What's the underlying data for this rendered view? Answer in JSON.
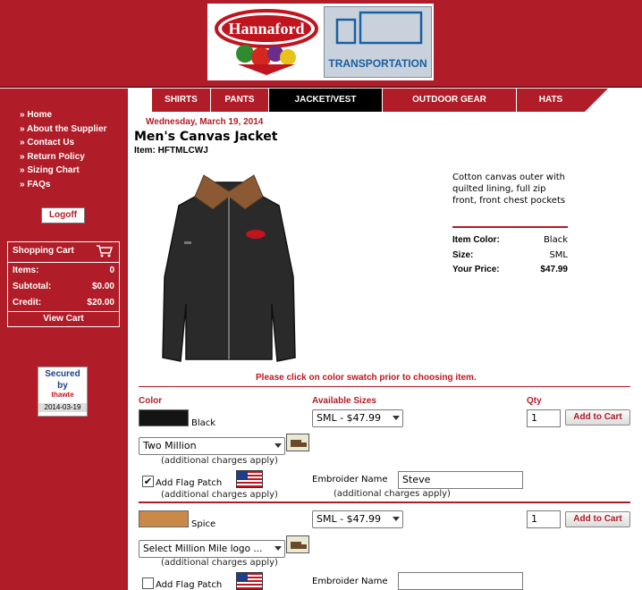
{
  "header": {
    "logo_text": "Hannaford",
    "logo_secondary_text": "TRANSPORTATION"
  },
  "nav": {
    "items": [
      {
        "label": "SHIRTS"
      },
      {
        "label": "PANTS"
      },
      {
        "label": "JACKET/VEST"
      },
      {
        "label": "OUTDOOR GEAR"
      },
      {
        "label": "HATS"
      }
    ]
  },
  "sidebar": {
    "links": [
      {
        "label": "» Home"
      },
      {
        "label": "» About the Supplier"
      },
      {
        "label": "» Contact Us"
      },
      {
        "label": "» Return Policy"
      },
      {
        "label": "» Sizing Chart"
      },
      {
        "label": "» FAQs"
      }
    ],
    "logoff_label": "Logoff",
    "cart": {
      "title": "Shopping Cart",
      "items_label": "Items:",
      "items_value": "0",
      "subtotal_label": "Subtotal:",
      "subtotal_value": "$0.00",
      "credit_label": "Credit:",
      "credit_value": "$20.00",
      "view_label": "View Cart"
    },
    "badge": {
      "line1": "Secured",
      "line2": "by",
      "line3": "thawte",
      "date": "2014-03-19"
    }
  },
  "product": {
    "date": "Wednesday, March 19, 2014",
    "title": "Men's Canvas Jacket",
    "item_number": "Item: HFTMLCWJ",
    "description": "Cotton canvas outer with quilted lining, full zip front, front chest pockets",
    "specs": {
      "color_label": "Item Color:",
      "color_value": "Black",
      "size_label": "Size:",
      "size_value": "SML",
      "price_label": "Your Price:",
      "price_value": "$47.99"
    },
    "notice": "Please click on color swatch prior to choosing item."
  },
  "order_table": {
    "headers": {
      "color": "Color",
      "sizes": "Available Sizes",
      "qty": "Qty"
    },
    "rows": [
      {
        "color_name": "Black",
        "swatch_color": "#141414",
        "size_selected": "SML - $47.99",
        "qty": "1",
        "button": "Add to Cart",
        "logo_selected": "Two Million",
        "additional_note": "(additional charges apply)",
        "flag_label": "Add Flag Patch",
        "flag_checked": "✔",
        "flag_note": "(additional charges apply)",
        "embroider_label": "Embroider Name",
        "embroider_value": "Steve",
        "embroider_note": "(additional charges apply)"
      },
      {
        "color_name": "Spice",
        "swatch_color": "#c98a49",
        "size_selected": "SML - $47.99",
        "qty": "1",
        "button": "Add to Cart",
        "logo_selected": "Select Million Mile logo ...",
        "additional_note": "(additional charges apply)",
        "flag_label": "Add Flag Patch",
        "flag_checked": "",
        "embroider_label": "Embroider Name",
        "embroider_value": ""
      }
    ]
  },
  "colors": {
    "brand_red": "#b01c27",
    "nav_active": "#000000",
    "notice_red": "#c0141e"
  }
}
